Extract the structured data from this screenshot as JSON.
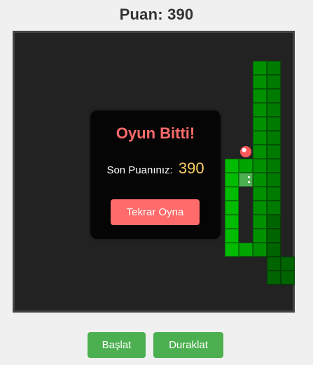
{
  "score": {
    "label": "Puan:",
    "value": "390",
    "text": "Puan: 390"
  },
  "game": {
    "snake_body_cells": [
      [
        17,
        2
      ],
      [
        18,
        2
      ],
      [
        17,
        3
      ],
      [
        18,
        3
      ],
      [
        17,
        4
      ],
      [
        18,
        4
      ],
      [
        17,
        5
      ],
      [
        18,
        5
      ],
      [
        17,
        6
      ],
      [
        18,
        6
      ],
      [
        17,
        7
      ],
      [
        18,
        7
      ],
      [
        17,
        8
      ],
      [
        18,
        8
      ],
      [
        17,
        9
      ],
      [
        18,
        9
      ],
      [
        17,
        10
      ],
      [
        18,
        10
      ],
      [
        17,
        11
      ],
      [
        18,
        11
      ],
      [
        17,
        12
      ],
      [
        18,
        12
      ],
      [
        17,
        13
      ],
      [
        18,
        13
      ],
      [
        17,
        14
      ],
      [
        18,
        14
      ],
      [
        17,
        15
      ],
      [
        18,
        15
      ],
      [
        19,
        16
      ],
      [
        18,
        16
      ],
      [
        19,
        17
      ],
      [
        18,
        17
      ],
      [
        16,
        15
      ],
      [
        15,
        15
      ],
      [
        15,
        14
      ],
      [
        15,
        13
      ],
      [
        15,
        12
      ],
      [
        15,
        11
      ],
      [
        15,
        10
      ],
      [
        15,
        9
      ],
      [
        16,
        9
      ]
    ],
    "snake_head_cell": [
      16,
      10
    ],
    "food_cell": [
      16,
      8
    ],
    "colors": {
      "board_bg": "#222222",
      "snake_bright": "#00bb00",
      "snake_dark": "#006400",
      "head": "#4caf50",
      "food": "#ff5b5b"
    }
  },
  "game_over": {
    "title": "Oyun Bitti!",
    "final_label": "Son Puanınız:",
    "final_value": "390",
    "replay_label": "Tekrar Oyna",
    "title_color": "#ff6b6b",
    "value_color": "#ffd166",
    "button_color": "#ff6b6b"
  },
  "controls": {
    "start_label": "Başlat",
    "pause_label": "Duraklat",
    "button_color": "#4caf50"
  }
}
